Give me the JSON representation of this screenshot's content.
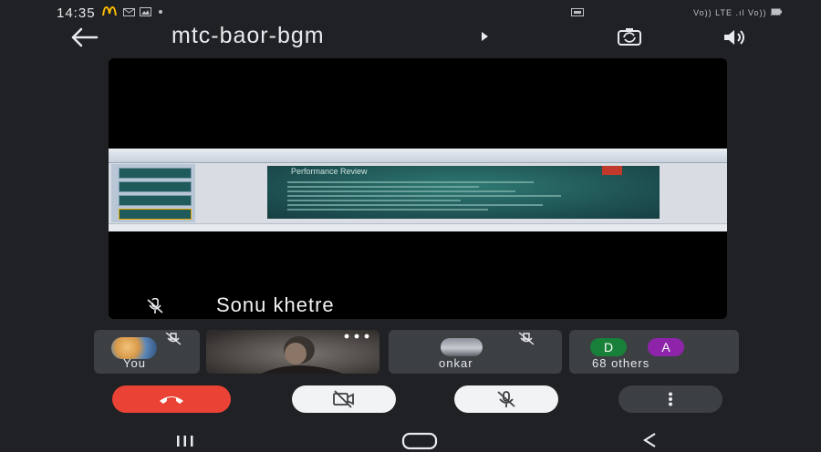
{
  "status_bar": {
    "time": "14:35",
    "right_text": "Vo)) LTE  .ıl  Vo)) .ıl"
  },
  "header": {
    "meeting_title": "mtc-baor-bgm"
  },
  "main_tile": {
    "participant_name": "Sonu khetre",
    "slide_title": "Performance Review"
  },
  "participants": {
    "you_label": "You",
    "onkar_label": "onkar",
    "others_label": "68 others",
    "avatar_d": "D",
    "avatar_a": "A"
  },
  "colors": {
    "end_call": "#ea4335",
    "background": "#202124",
    "tile": "#3c4043"
  },
  "icons": {
    "back": "arrow-left-icon",
    "switch_camera": "switch-camera-icon",
    "speaker": "speaker-icon",
    "mic_off": "mic-off-icon",
    "end_call": "phone-hangup-icon",
    "camera_off": "camera-off-icon",
    "more": "more-vert-icon",
    "more_horiz": "more-horiz-icon",
    "recents": "recents-icon",
    "home": "home-icon",
    "back_nav": "back-nav-icon",
    "mcd": "mcdonalds-icon",
    "mail": "mail-icon",
    "gallery": "gallery-icon",
    "battery": "battery-icon"
  }
}
